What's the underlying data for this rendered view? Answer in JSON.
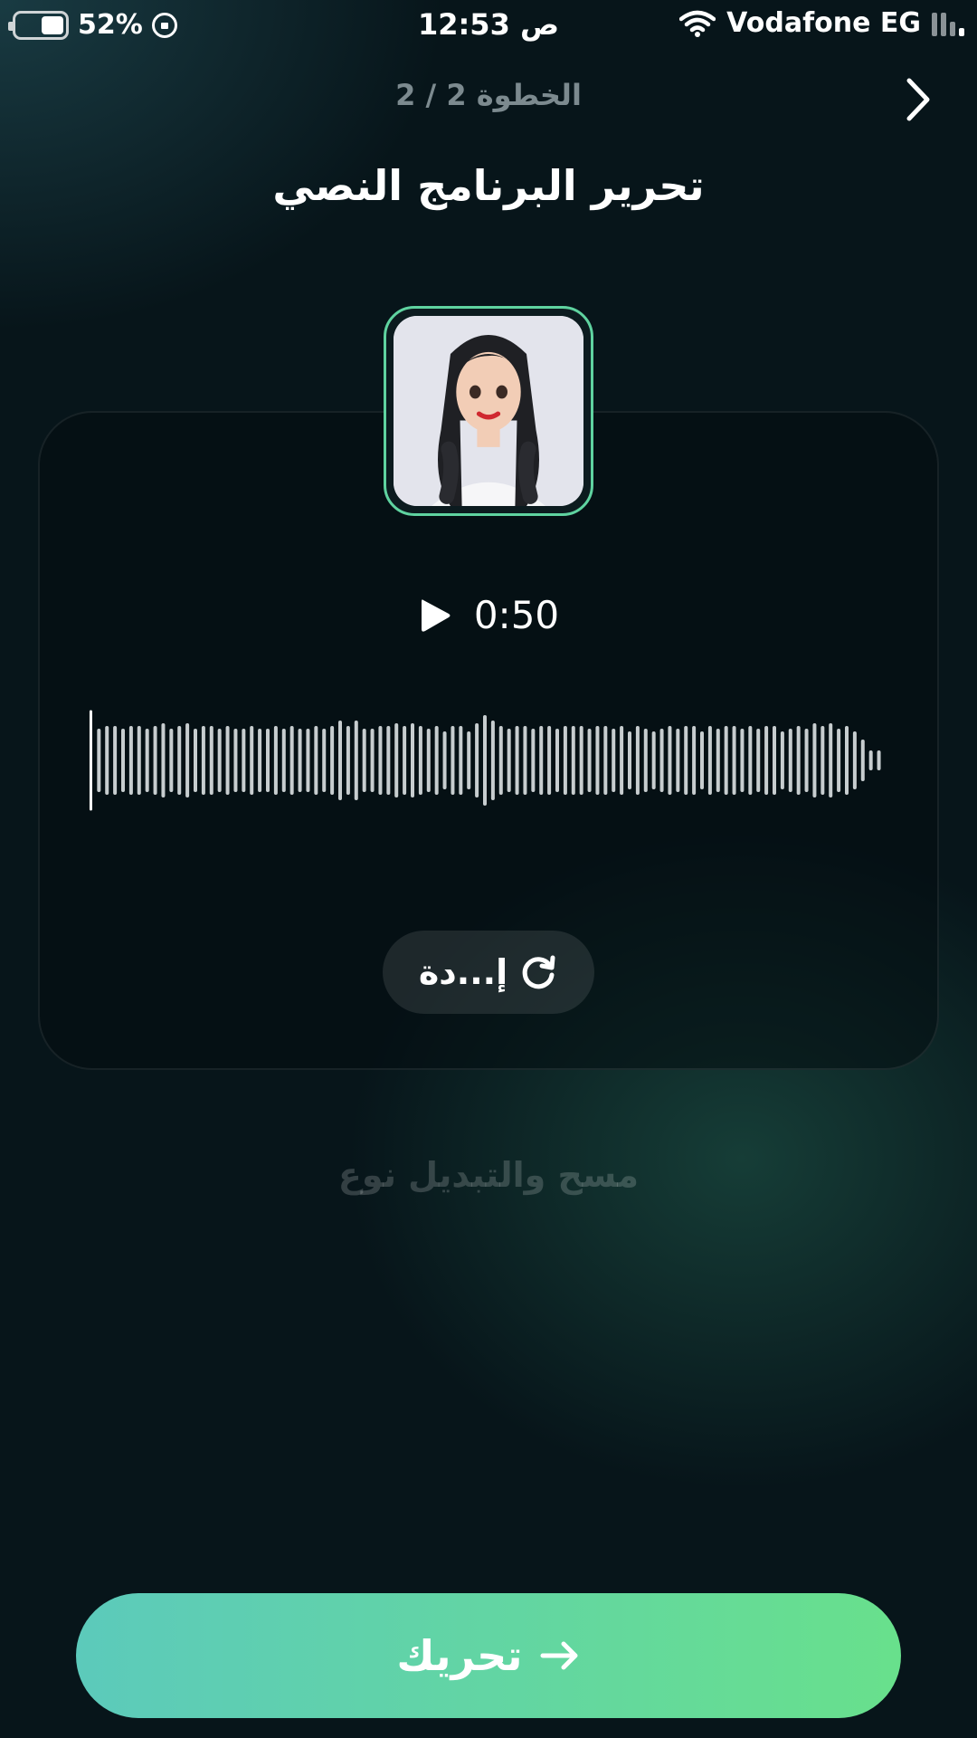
{
  "status_bar": {
    "battery_percent": "52%",
    "time": "12:53 ص",
    "carrier": "Vodafone EG",
    "battery_level": 0.52
  },
  "header": {
    "step": "الخطوة 2 / 2",
    "title": "تحرير البرنامج النصي",
    "back_icon": "chevron-right-icon"
  },
  "audio": {
    "duration": "0:50",
    "play_icon": "play-icon",
    "retry_label": "إ...دة",
    "retry_icon": "refresh-icon",
    "waveform_levels": [
      0.9,
      0.55,
      0.6,
      0.6,
      0.55,
      0.6,
      0.6,
      0.55,
      0.6,
      0.65,
      0.55,
      0.6,
      0.65,
      0.55,
      0.6,
      0.6,
      0.55,
      0.6,
      0.55,
      0.55,
      0.6,
      0.55,
      0.55,
      0.6,
      0.55,
      0.6,
      0.55,
      0.55,
      0.6,
      0.55,
      0.6,
      0.7,
      0.6,
      0.7,
      0.55,
      0.55,
      0.6,
      0.6,
      0.65,
      0.6,
      0.65,
      0.6,
      0.55,
      0.6,
      0.5,
      0.6,
      0.6,
      0.5,
      0.65,
      0.8,
      0.7,
      0.6,
      0.55,
      0.6,
      0.6,
      0.55,
      0.6,
      0.6,
      0.55,
      0.6,
      0.6,
      0.6,
      0.55,
      0.6,
      0.6,
      0.55,
      0.6,
      0.5,
      0.6,
      0.55,
      0.5,
      0.55,
      0.6,
      0.55,
      0.6,
      0.6,
      0.5,
      0.6,
      0.55,
      0.6,
      0.6,
      0.55,
      0.6,
      0.55,
      0.6,
      0.6,
      0.5,
      0.55,
      0.6,
      0.55,
      0.65,
      0.6,
      0.65,
      0.55,
      0.6,
      0.5,
      0.35,
      0.15,
      0.15
    ]
  },
  "clear_link": "مسح والتبديل نوع",
  "cta": {
    "label": "تحريك",
    "arrow_icon": "arrow-right-icon"
  },
  "colors": {
    "accent_start": "#5ccabb",
    "accent_end": "#68e08c",
    "avatar_border": "#5fd3a0"
  }
}
